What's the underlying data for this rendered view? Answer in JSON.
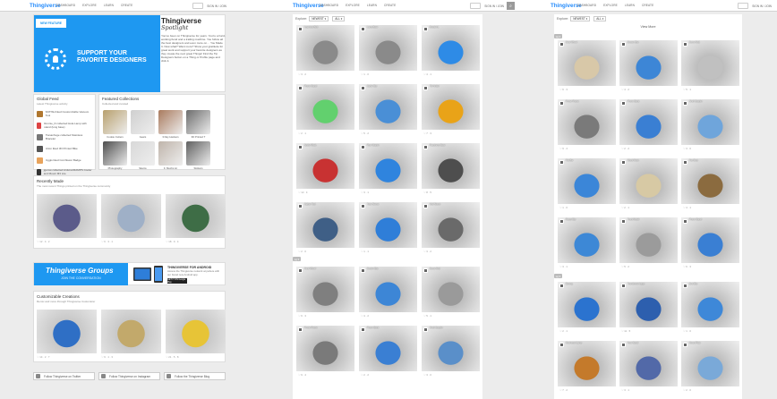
{
  "panel1": {
    "logo": "Thingiverse",
    "nav": [
      "DASHBOARD",
      "EXPLORE",
      "LEARN",
      "CREATE"
    ],
    "signin": "SIGN IN / JOIN",
    "hero": {
      "badge": "NEW FEATURE",
      "headline1": "SUPPORT YOUR",
      "headline2": "FAVORITE DESIGNERS",
      "spotlight_title": "Thingiverse",
      "spotlight_sub": "Spotlight",
      "spotlight_body": "You've been on Thingiverse for years. You're a hard-working fiend and a trailing machine. You follow all the best designers and even more on… You Made It. Now what? Want more? Show your gratitude for great work and support your favorite designers as they create the next great Things! Find the Tip Designers button on a Thing or Profile page and click it."
    },
    "trend": {
      "title": "Global Feed",
      "subtitle": "Latest Thingiverse activity",
      "items": [
        {
          "text": "SNTISH liked Customizable Vacuum Tool",
          "color": "#b0772f"
        },
        {
          "text": "Ronnie_D collected Hula Lamp with stand (long base)",
          "color": "#d44"
        },
        {
          "text": "Tiananhuge collected Stainless Bracelet",
          "color": "#777"
        },
        {
          "text": "Arion liked 3D Printed Bike",
          "color": "#555"
        },
        {
          "text": "Uggis liked Cornflower Badge",
          "color": "#e8a35c"
        },
        {
          "text": "jgerow collected Arduino/RAMPS Cooler and Mount M3 Lite",
          "color": "#333"
        }
      ]
    },
    "featured": {
      "title": "Featured Collections",
      "subtitle": "Collected and curated",
      "items": [
        {
          "label": "Cookie Cutters",
          "color": "#b8a06d"
        },
        {
          "label": "Gears",
          "color": "#cfcfcf"
        },
        {
          "label": "3 Day Hackers",
          "color": "#a97a5d"
        },
        {
          "label": "3D Printed T",
          "color": "#6c6c6c"
        },
        {
          "label": "Photography",
          "color": "#4d4d4d"
        },
        {
          "label": "Skeins",
          "color": "#d8d8d8"
        },
        {
          "label": "F. Mechs Lit",
          "color": "#bfb4aa"
        },
        {
          "label": "Stickers",
          "color": "#606060"
        }
      ]
    },
    "recent": {
      "title": "Recently Made",
      "subtitle": "The most recent Things printed on the Thingiverse community",
      "items": [
        {
          "stat": "♡ 12 · 4 · 2",
          "color": "#5b5b8a"
        },
        {
          "stat": "♡ 6 · 3 · 1",
          "color": "#9fb0c7"
        },
        {
          "stat": "♡ 18 · 9 · 4",
          "color": "#3e6d46"
        }
      ]
    },
    "groups": {
      "title": "Thingiverse Groups",
      "subtitle": "JOIN THE CONVERSATION",
      "app_title": "THINGIVERSE FOR ANDROID",
      "app_body": "Access the Thingiverse network anywhere with our brand new Android app.",
      "store": "GET IT ON Google Play"
    },
    "custom": {
      "title": "Customizable Creations",
      "subtitle": "Remix and more through Thingiverse Customizer",
      "items": [
        {
          "stat": "♡ 14 · 2 · 7",
          "color": "#2f6fc5"
        },
        {
          "stat": "♡ 9 · 1 · 3",
          "color": "#c2a96b"
        },
        {
          "stat": "♡ 21 · 5 · 8",
          "color": "#e7c437"
        }
      ]
    },
    "social": [
      {
        "label": "Follow Thingiverse on Twitter"
      },
      {
        "label": "Follow Thingiverse on Instagram"
      },
      {
        "label": "Follow the Thingiverse Blog"
      }
    ]
  },
  "panel2": {
    "sort_label": "Explore:",
    "sort_value": "NEWEST ▾",
    "filter_value": "ALL ▾",
    "page_tag": "pg 2",
    "tiles": [
      {
        "color": "#8a8a8a",
        "name": "Ingenious Bolt",
        "stat": "♡ 3 · 2"
      },
      {
        "color": "#8a8a8a",
        "name": "Lamp Base",
        "stat": "♡ 1 · 0"
      },
      {
        "color": "#2e8be6",
        "name": "Bracket L",
        "stat": "♡ 4 · 1"
      },
      {
        "color": "#62d06e",
        "name": "Phone Stand",
        "stat": "♡ 2 · 1"
      },
      {
        "color": "#4a8fd6",
        "name": "Cable Clip",
        "stat": "♡ 5 · 2"
      },
      {
        "color": "#e9a318",
        "name": "Tilt Holder",
        "stat": "♡ 7 · 3"
      },
      {
        "color": "#c83232",
        "name": "Spider Mask",
        "stat": "♡ 12 · 4"
      },
      {
        "color": "#2f84de",
        "name": "Pipe Adapter",
        "stat": "♡ 3 · 1"
      },
      {
        "color": "#4e4e4e",
        "name": "Raspberry Case",
        "stat": "♡ 8 · 5"
      },
      {
        "color": "#3f5f86",
        "name": "Caliper Tool",
        "stat": "♡ 2 · 0"
      },
      {
        "color": "#2f7ed8",
        "name": "Tube Sleeve",
        "stat": "♡ 1 · 1"
      },
      {
        "color": "#6a6a6a",
        "name": "Wall Mount",
        "stat": "♡ 3 · 2"
      },
      {
        "color": "#7f7f7f",
        "name": "Gear Wheel",
        "stat": "♡ 6 · 3"
      },
      {
        "color": "#3d86d6",
        "name": "Drawer Box",
        "stat": "♡ 4 · 2"
      },
      {
        "color": "#9a9a9a",
        "name": "Dome Grid",
        "stat": "♡ 5 · 1"
      },
      {
        "color": "#7a7a7a",
        "name": "Printer Frame",
        "stat": "♡ 9 · 4"
      },
      {
        "color": "#3a7fd3",
        "name": "Phone Dock",
        "stat": "♡ 2 · 2"
      },
      {
        "color": "#5a8fc9",
        "name": "Shaft Coupler",
        "stat": "♡ 3 · 0"
      },
      {
        "color": "#5a7f5a",
        "name": "Box Lid",
        "stat": "♡ 1 · 0"
      },
      {
        "color": "#9f9f9f",
        "name": "Bracket Set",
        "stat": "♡ 2 · 1"
      },
      {
        "color": "#8b6b3f",
        "name": "Fan Duct",
        "stat": "♡ 4 · 1"
      }
    ]
  },
  "panel3": {
    "sort_label": "Explore:",
    "sort_value": "NEWEST ▾",
    "filter_value": "ALL ▾",
    "view_more": "View More",
    "page_tag1": "pg 2",
    "page_tag2": "pg 3",
    "tiles": [
      {
        "color": "#d8c8a8",
        "name": "Gear Wheel",
        "stat": "♡ 6 · 3"
      },
      {
        "color": "#3d86d6",
        "name": "Drawer Box",
        "stat": "♡ 4 · 2"
      },
      {
        "color": "#c0c0c0",
        "name": "Dome Grid",
        "stat": "♡ 5 · 1"
      },
      {
        "color": "#7a7a7a",
        "name": "Printer Frame",
        "stat": "♡ 9 · 4"
      },
      {
        "color": "#3a7fd3",
        "name": "Phone Dock",
        "stat": "♡ 2 · 2"
      },
      {
        "color": "#6fa5db",
        "name": "Shaft Coupler",
        "stat": "♡ 3 · 0"
      },
      {
        "color": "#3b86d8",
        "name": "Flat Bar",
        "stat": "♡ 1 · 0"
      },
      {
        "color": "#d7c9a4",
        "name": "Wood Grain",
        "stat": "♡ 2 · 1"
      },
      {
        "color": "#8b6b3f",
        "name": "Fan Duct",
        "stat": "♡ 4 · 1"
      },
      {
        "color": "#3d88d6",
        "name": "Ramp Clip",
        "stat": "♡ 3 · 1"
      },
      {
        "color": "#9b9b9b",
        "name": "Truck Model",
        "stat": "♡ 5 · 2"
      },
      {
        "color": "#3a7fd3",
        "name": "Phone Stand",
        "stat": "♡ 6 · 3"
      },
      {
        "color": "#2b73cf",
        "name": "Earring",
        "stat": "♡ 2 · 1"
      },
      {
        "color": "#2d5fae",
        "name": "Transformer Logo",
        "stat": "♡ 11 · 5"
      },
      {
        "color": "#3e88d8",
        "name": "Bed Clip",
        "stat": "♡ 1 · 0"
      },
      {
        "color": "#c47a2b",
        "name": "Mushroom Lamp",
        "stat": "♡ 7 · 2"
      },
      {
        "color": "#5269a8",
        "name": "Vase Spiral",
        "stat": "♡ 3 · 1"
      },
      {
        "color": "#7aa9d8",
        "name": "Mount Plate",
        "stat": "♡ 2 · 0"
      }
    ]
  }
}
